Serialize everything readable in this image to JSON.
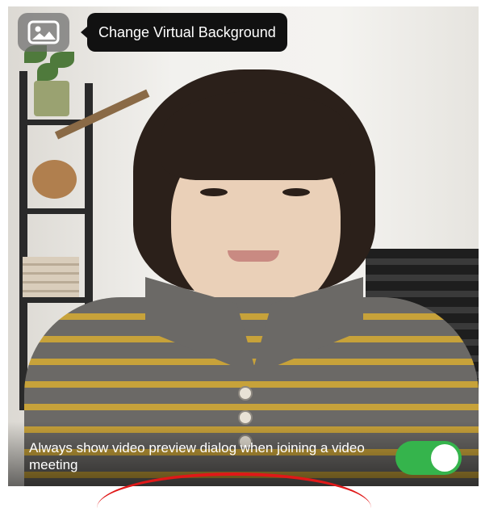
{
  "header": {
    "background_button_icon": "image-icon",
    "tooltip_text": "Change Virtual Background"
  },
  "preview": {
    "description_toggle_label": "Always show video preview dialog when joining a video meeting",
    "toggle_state": "on",
    "toggle_color": "#35b44c"
  },
  "colors": {
    "tooltip_bg": "#111111",
    "annotation_arc": "#e01818"
  }
}
